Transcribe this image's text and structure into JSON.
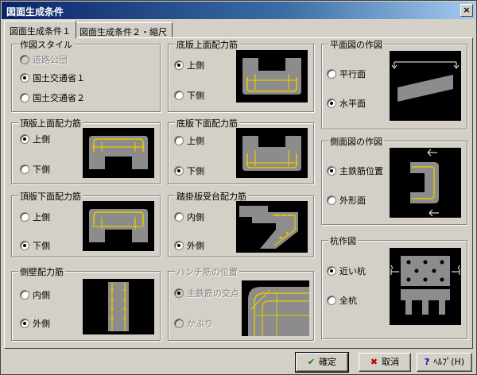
{
  "window": {
    "title": "図面生成条件",
    "close_label": "×"
  },
  "tabs": [
    {
      "label": "図面生成条件１"
    },
    {
      "label": "図面生成条件２・縮尺"
    }
  ],
  "groups": {
    "drawing_style": {
      "title": "作図スタイル",
      "options": [
        "道路公団",
        "国土交通省１",
        "国土交通省２"
      ],
      "selected": 1
    },
    "top_slab_top": {
      "title": "頂版上面配力筋",
      "options": [
        "上側",
        "下側"
      ],
      "selected": 0
    },
    "top_slab_bottom": {
      "title": "頂版下面配力筋",
      "options": [
        "上側",
        "下側"
      ],
      "selected": 1
    },
    "side_wall": {
      "title": "側壁配力筋",
      "options": [
        "内側",
        "外側"
      ],
      "selected": 1
    },
    "bottom_slab_top": {
      "title": "底版上面配力筋",
      "options": [
        "上側",
        "下側"
      ],
      "selected": 0
    },
    "bottom_slab_bottom": {
      "title": "底版下面配力筋",
      "options": [
        "上側",
        "下側"
      ],
      "selected": 1
    },
    "approach_slab": {
      "title": "踏掛版受台配力筋",
      "options": [
        "内側",
        "外側"
      ],
      "selected": 1
    },
    "haunch": {
      "title": "ハンチ筋の位置",
      "options": [
        "主鉄筋の交点",
        "かぶり"
      ],
      "selected": 0
    },
    "plan_view": {
      "title": "平面図の作図",
      "options": [
        "平行面",
        "水平面"
      ],
      "selected": 1
    },
    "side_view": {
      "title": "側面図の作図",
      "options": [
        "主鉄筋位置",
        "外形面"
      ],
      "selected": 0
    },
    "pile": {
      "title": "杭作図",
      "options": [
        "近い杭",
        "全杭"
      ],
      "selected": 0
    }
  },
  "buttons": {
    "ok": {
      "label": "確定",
      "icon": "check-icon"
    },
    "cancel": {
      "label": "取消",
      "icon": "cross-icon"
    },
    "help": {
      "label": "ﾍﾙﾌﾟ(H)",
      "icon": "question-icon"
    }
  },
  "colors": {
    "rebar": "#e8c800",
    "concrete": "#8c8c8c",
    "panel": "#d4d0c8",
    "title_start": "#0a246a",
    "ok_icon": "#008000",
    "cancel_icon": "#c00000",
    "help_icon": "#0000c0"
  }
}
